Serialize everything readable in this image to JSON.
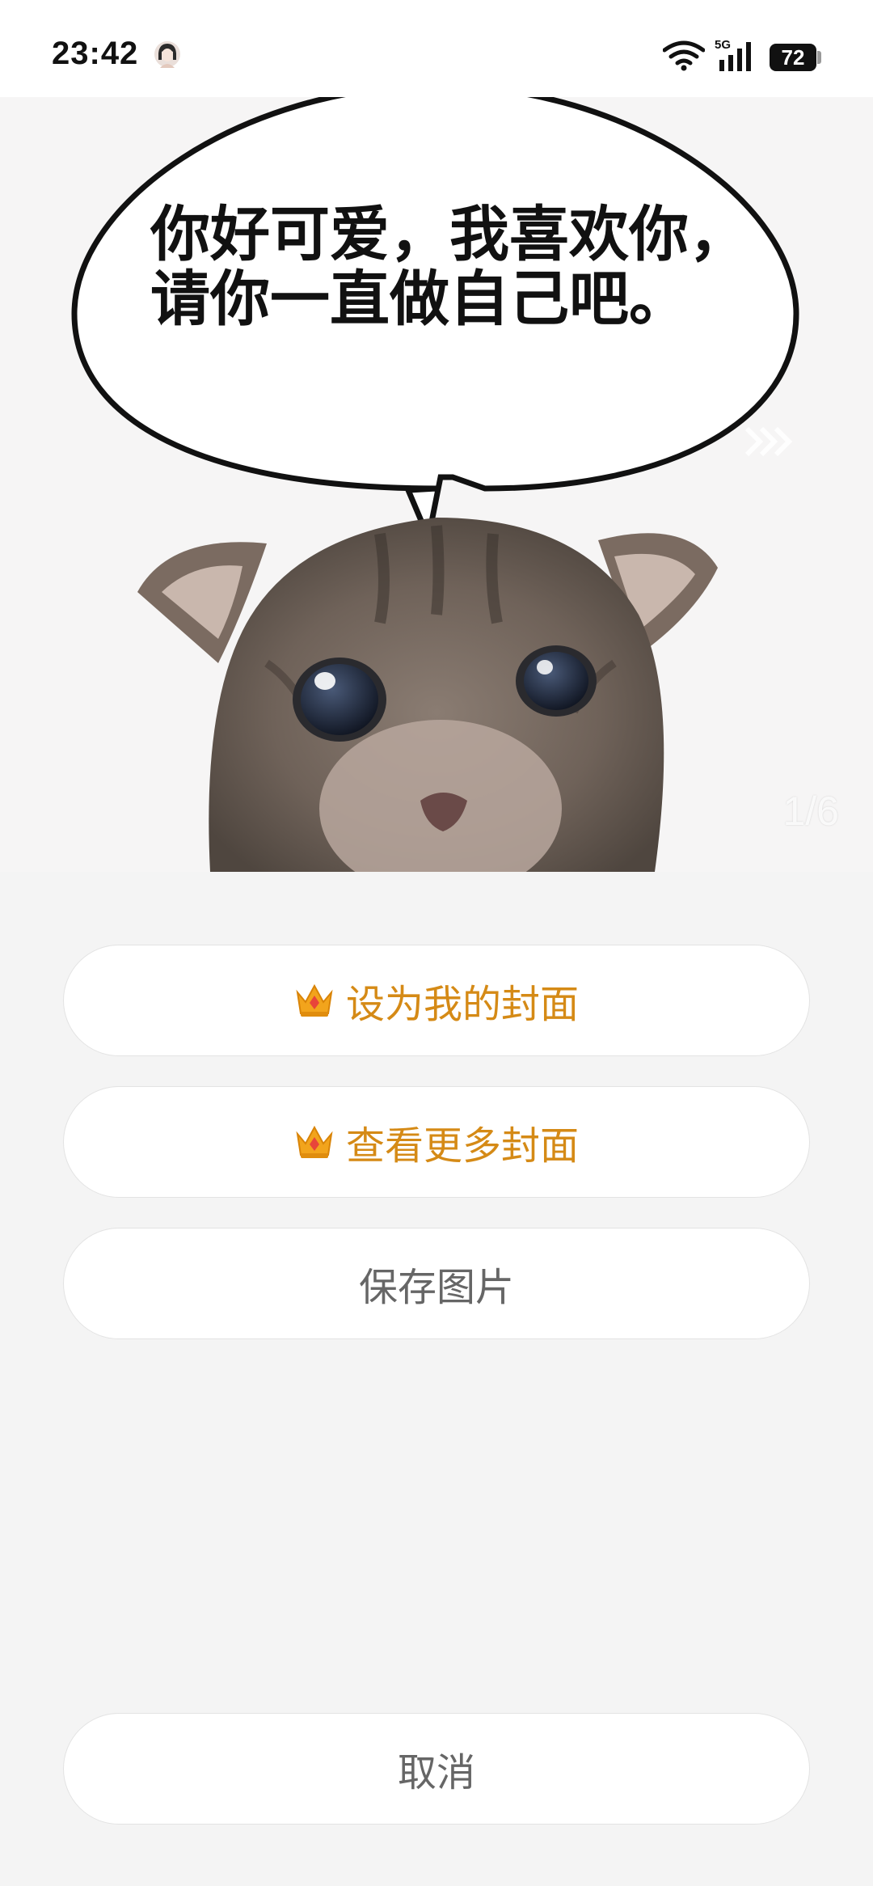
{
  "status_bar": {
    "time": "23:42",
    "network": "5G",
    "battery": "72"
  },
  "preview": {
    "caption_line1": "你好可爱，我喜欢你，",
    "caption_line2": "请你一直做自己吧。",
    "page_indicator": "1/6"
  },
  "actions": {
    "set_cover_label": "设为我的封面",
    "more_covers_label": "查看更多封面",
    "save_image_label": "保存图片",
    "cancel_label": "取消"
  },
  "colors": {
    "vip_accent": "#d58a16",
    "plain_text": "#666666",
    "sheet_background": "#f4f4f4"
  },
  "icons": [
    "avatar-icon",
    "wifi-icon",
    "signal-icon",
    "battery-icon",
    "swipe-hint-icon",
    "crown-icon"
  ]
}
